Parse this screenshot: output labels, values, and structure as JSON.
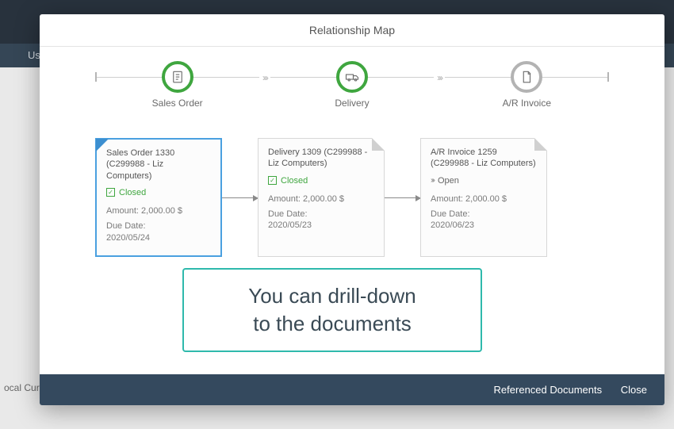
{
  "background": {
    "nav_label": "Us",
    "local_currency_label": "ocal Curre",
    "top_corner": ""
  },
  "modal": {
    "title": "Relationship Map",
    "footer": {
      "referenced": "Referenced Documents",
      "close": "Close"
    }
  },
  "flow": {
    "steps": [
      {
        "label": "Sales Order",
        "color": "green",
        "icon": "order"
      },
      {
        "label": "Delivery",
        "color": "green",
        "icon": "truck"
      },
      {
        "label": "A/R Invoice",
        "color": "gray",
        "icon": "doc"
      }
    ]
  },
  "cards": [
    {
      "title": "Sales Order 1330 (C299988 - Liz Computers)",
      "status": "Closed",
      "status_kind": "closed",
      "amount_label": "Amount: 2,000.00 $",
      "due_label": "Due Date:",
      "due_value": "2020/05/24",
      "selected": true
    },
    {
      "title": "Delivery 1309 (C299988 - Liz Computers)",
      "status": "Closed",
      "status_kind": "closed",
      "amount_label": "Amount: 2,000.00 $",
      "due_label": "Due Date:",
      "due_value": "2020/05/23",
      "selected": false
    },
    {
      "title": "A/R Invoice 1259 (C299988 - Liz Computers)",
      "status": "Open",
      "status_kind": "open",
      "amount_label": "Amount: 2,000.00 $",
      "due_label": "Due Date:",
      "due_value": "2020/06/23",
      "selected": false
    }
  ],
  "callout": {
    "line1": "You can drill-down",
    "line2": "to the documents"
  }
}
